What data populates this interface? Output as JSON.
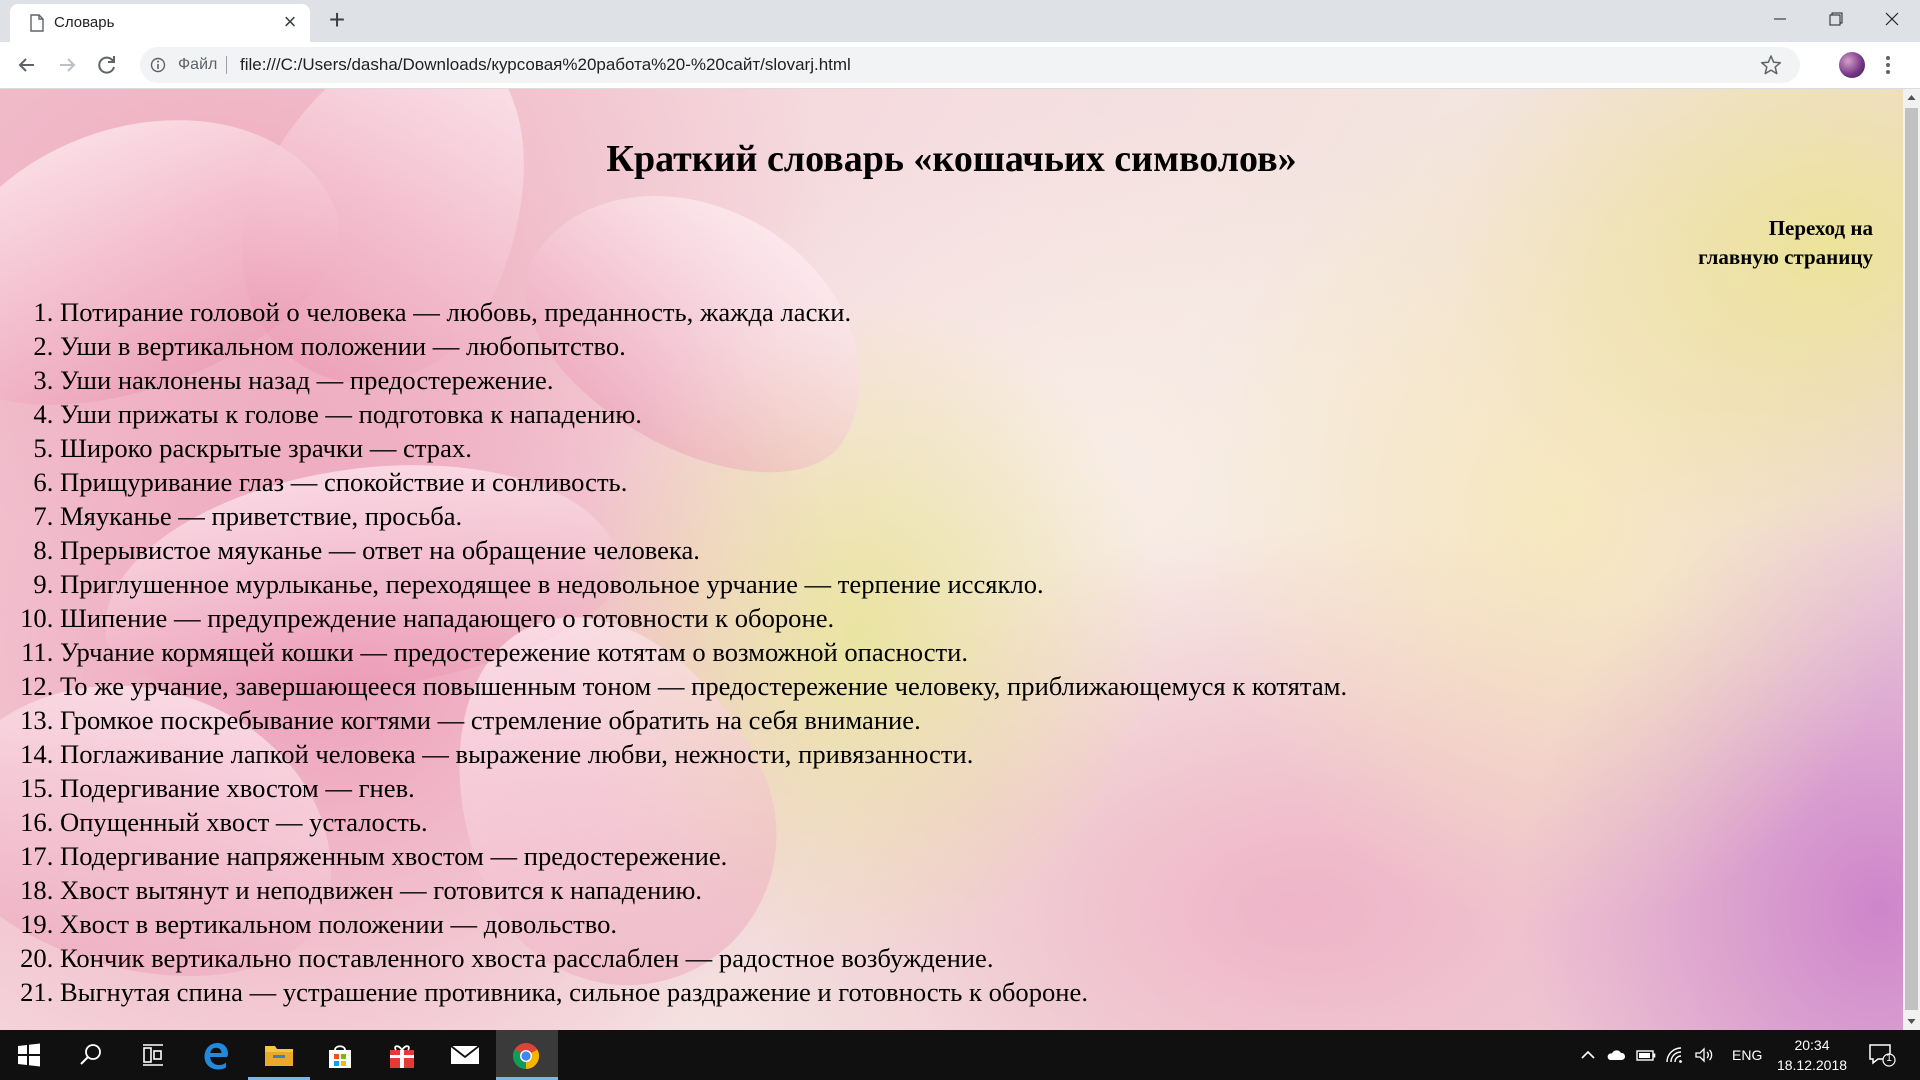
{
  "browser": {
    "tab_title": "Словарь",
    "tab_close": "×",
    "new_tab": "+",
    "scheme_label": "Файл",
    "url": "file:///C:/Users/dasha/Downloads/курсовая%20работа%20-%20сайт/slovarj.html"
  },
  "page": {
    "title": "Краткий словарь «кошачьих символов»",
    "home_link_line1": "Переход на",
    "home_link_line2": "главную страницу",
    "symbols": [
      "Потирание головой о человека — любовь, преданность, жажда ласки.",
      "Уши в вертикальном положении — любопытство.",
      "Уши наклонены назад — предостережение.",
      "Уши прижаты к голове — подготовка к нападению.",
      "Широко раскрытые зрачки — страх.",
      "Прищуривание глаз — спокойствие и сонливость.",
      "Мяуканье — приветствие, просьба.",
      "Прерывистое мяуканье — ответ на обращение человека.",
      "Приглушенное мурлыканье, переходящее в недовольное урчание — терпение иссякло.",
      "Шипение — предупреждение нападающего о готовности к обороне.",
      "Урчание кормящей кошки — предостережение котятам о возможной опасности.",
      "То же урчание, завершающееся повышенным тоном — предостережение человеку, приближающемуся к котятам.",
      "Громкое поскребывание когтями — стремление обратить на себя внимание.",
      "Поглаживание лапкой человека — выражение любви, нежности, привязанности.",
      "Подергивание хвостом — гнев.",
      "Опущенный хвост — усталость.",
      "Подергивание напряженным хвостом — предостережение.",
      "Хвост вытянут и неподвижен — готовится к нападению.",
      "Хвост в вертикальном положении — довольство.",
      "Кончик вертикально поставленного хвоста расслаблен — радостное возбуждение.",
      "Выгнутая спина — устрашение противника, сильное раздражение и готовность к обороне."
    ]
  },
  "taskbar": {
    "items": [
      {
        "name": "start-button",
        "icon": "windows-icon"
      },
      {
        "name": "search-button",
        "icon": "search-icon"
      },
      {
        "name": "task-view-button",
        "icon": "task-view-icon"
      },
      {
        "name": "edge-button",
        "icon": "edge-icon"
      },
      {
        "name": "file-explorer-button",
        "icon": "folder-icon"
      },
      {
        "name": "store-button",
        "icon": "store-icon"
      },
      {
        "name": "gift-app-button",
        "icon": "gift-icon"
      },
      {
        "name": "mail-button",
        "icon": "mail-icon"
      },
      {
        "name": "chrome-button",
        "icon": "chrome-icon"
      }
    ],
    "language": "ENG",
    "time": "20:34",
    "date": "18.12.2018",
    "notification_count": "1"
  },
  "colors": {
    "taskbar_bg": "#101010",
    "active_underline": "#7eb4ea",
    "omnibox_bg": "#f1f3f4",
    "tab_strip_bg": "#dee1e6"
  }
}
